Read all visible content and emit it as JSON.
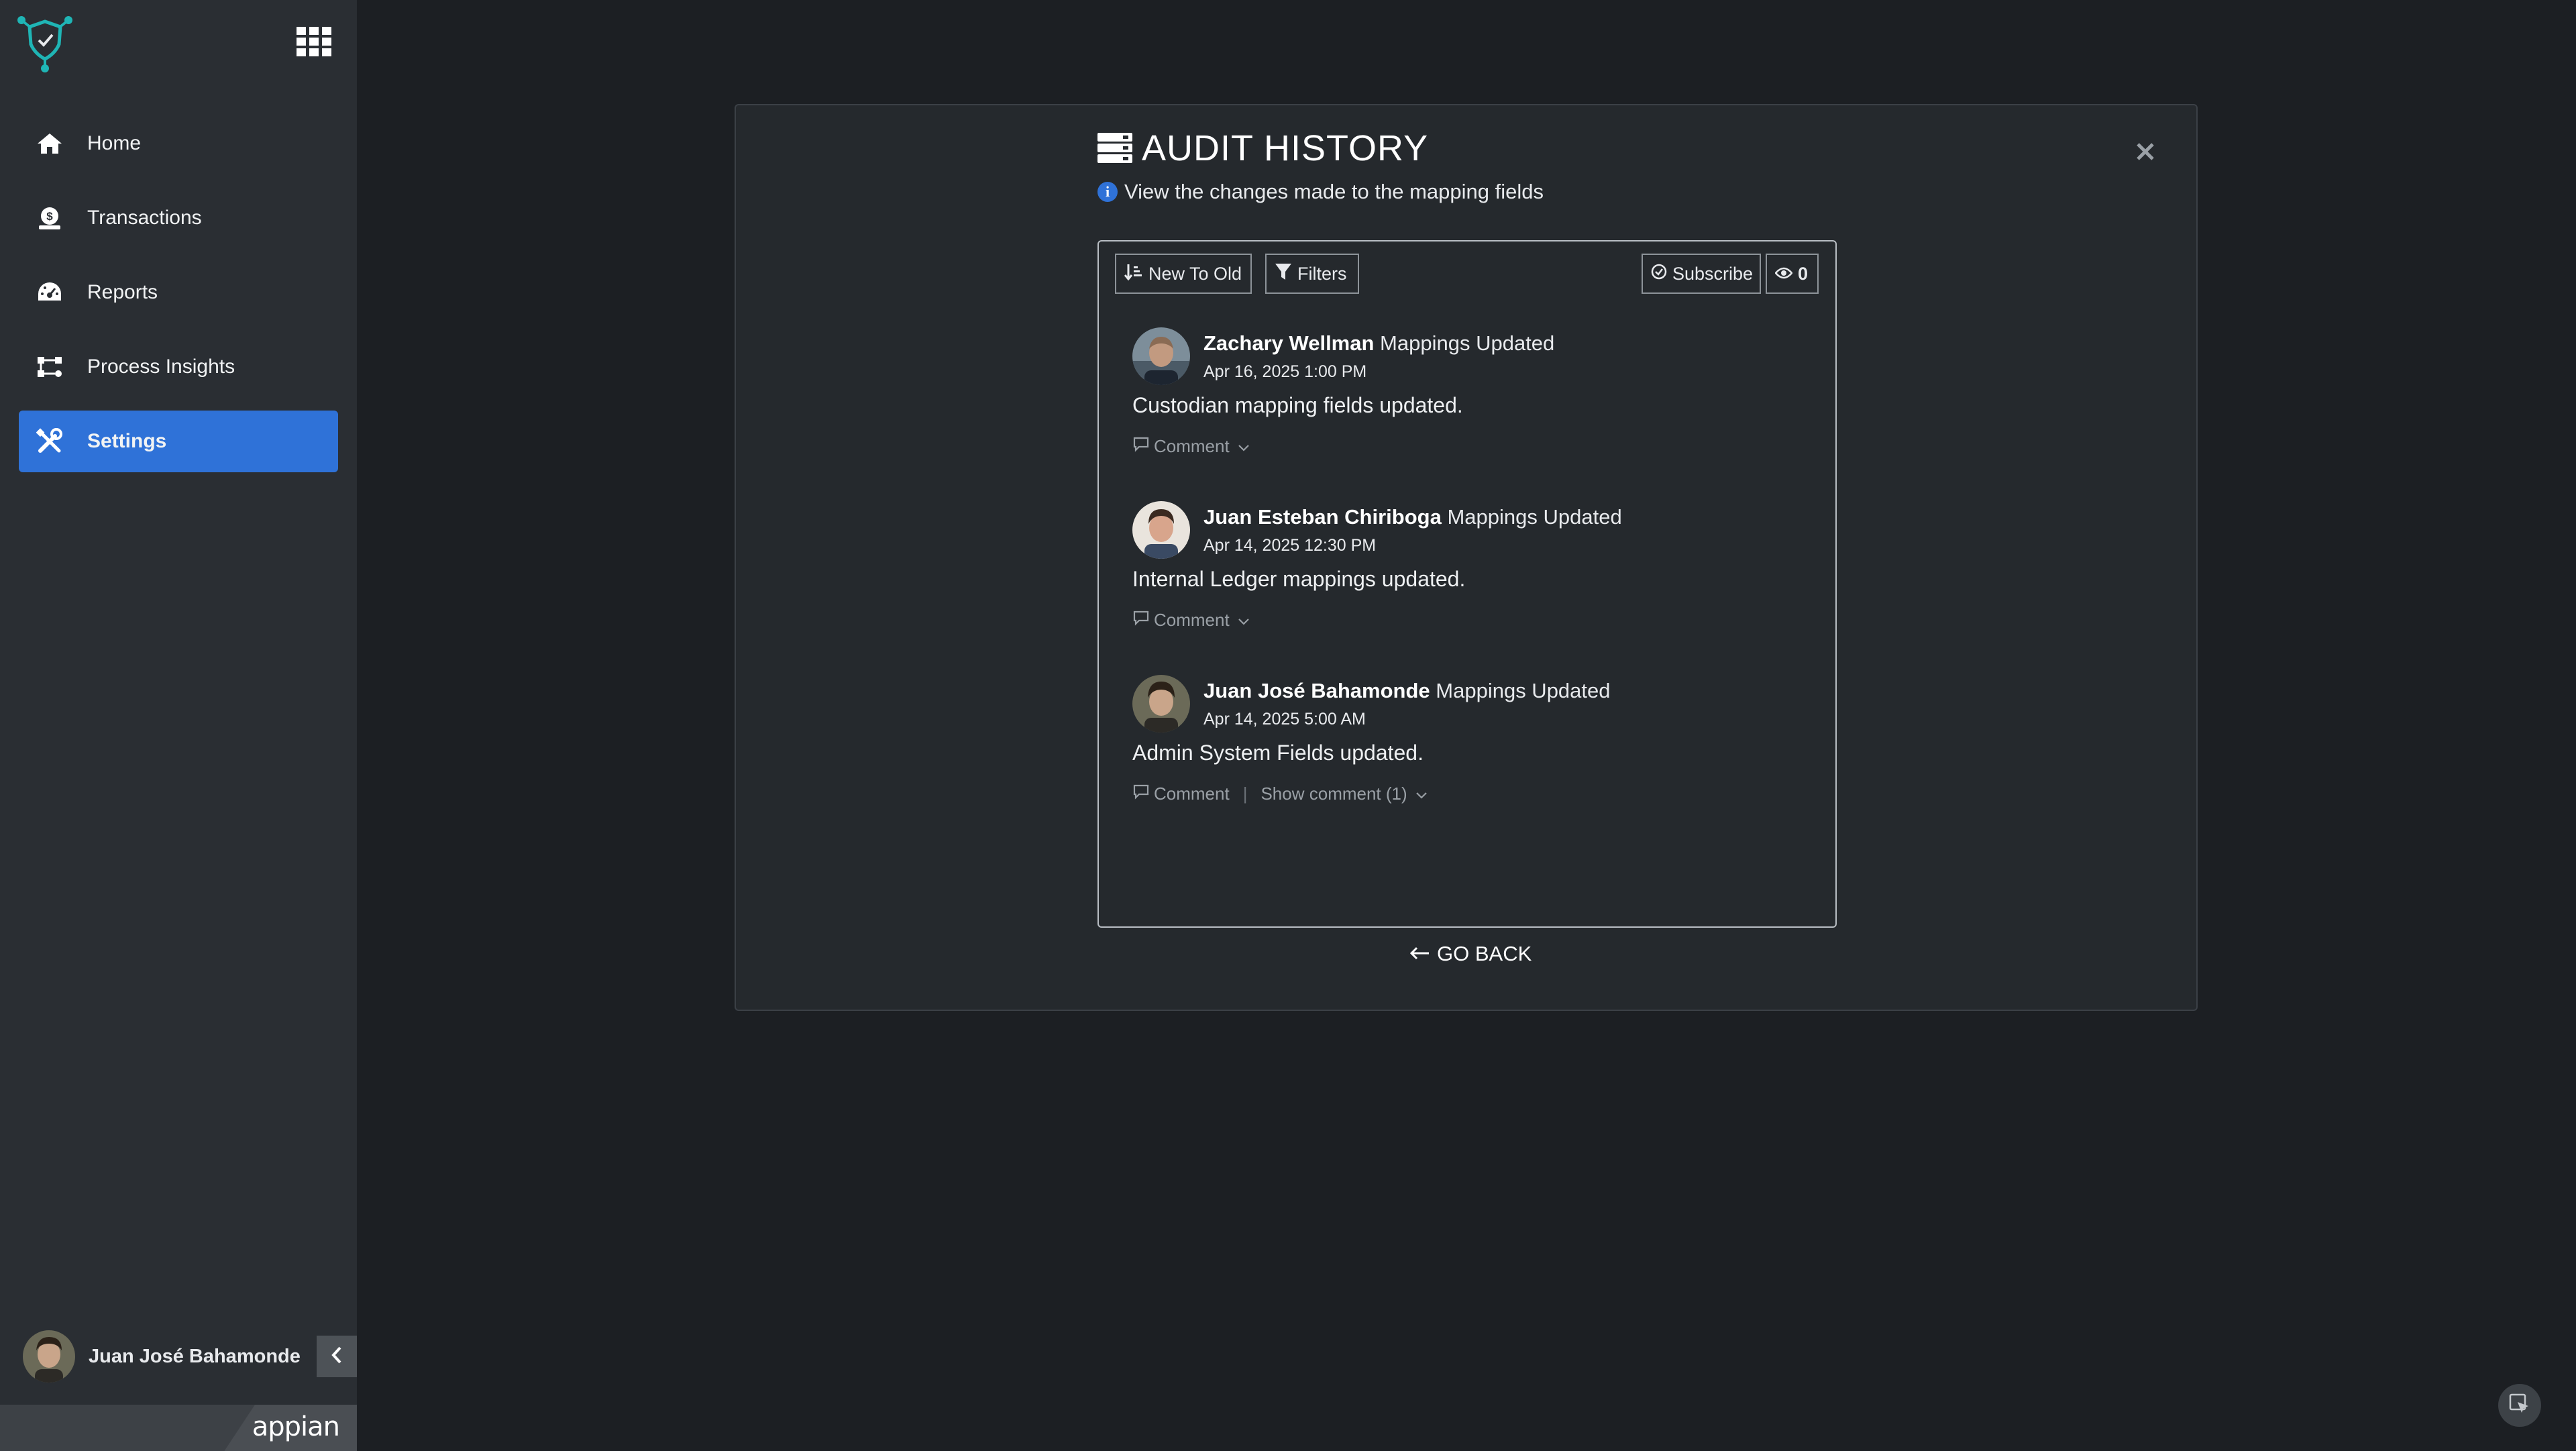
{
  "sidebar": {
    "items": [
      {
        "label": "Home",
        "icon": "home-icon"
      },
      {
        "label": "Transactions",
        "icon": "money-bag-icon"
      },
      {
        "label": "Reports",
        "icon": "dashboard-gauge-icon"
      },
      {
        "label": "Process Insights",
        "icon": "process-flow-icon"
      },
      {
        "label": "Settings",
        "icon": "tools-icon",
        "active": true
      }
    ],
    "user_name": "Juan José Bahamonde",
    "brand": "appian",
    "accent_color": "#2f72d8"
  },
  "dialog": {
    "title": "AUDIT HISTORY",
    "subtitle": "View the changes made to the mapping fields",
    "toolbar": {
      "sort_label": "New To Old",
      "filters_label": "Filters",
      "subscribe_label": "Subscribe",
      "watchers_count": "0"
    },
    "entries": [
      {
        "name": "Zachary Wellman",
        "action": "Mappings Updated",
        "date": "Apr 16, 2025 1:00 PM",
        "description": "Custodian mapping fields updated.",
        "comment_label": "Comment"
      },
      {
        "name": "Juan Esteban Chiriboga",
        "action": "Mappings Updated",
        "date": "Apr 14, 2025 12:30 PM",
        "description": "Internal Ledger mappings updated.",
        "comment_label": "Comment"
      },
      {
        "name": "Juan José Bahamonde",
        "action": "Mappings Updated",
        "date": "Apr 14, 2025 5:00 AM",
        "description": "Admin System Fields updated.",
        "comment_label": "Comment",
        "show_comment_label": "Show comment (1)"
      }
    ],
    "go_back_label": "GO BACK"
  }
}
